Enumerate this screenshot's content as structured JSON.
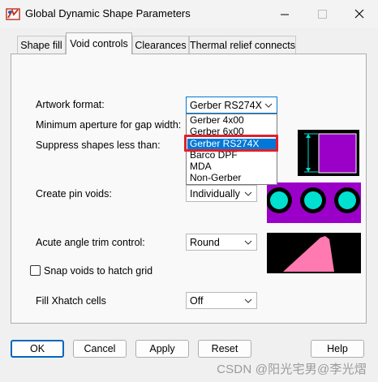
{
  "window": {
    "title": "Global Dynamic Shape Parameters",
    "minimize_icon": "minimize-icon",
    "maximize_icon": "maximize-icon",
    "close_icon": "close-icon"
  },
  "tabs": [
    {
      "label": "Shape fill",
      "active": false
    },
    {
      "label": "Void controls",
      "active": true
    },
    {
      "label": "Clearances",
      "active": false
    },
    {
      "label": "Thermal relief connects",
      "active": false
    }
  ],
  "void_controls": {
    "artwork_format": {
      "label": "Artwork format:",
      "value": "Gerber RS274X"
    },
    "min_aperture": {
      "label": "Minimum aperture for gap width:"
    },
    "suppress_shapes": {
      "label": "Suppress shapes less than:"
    },
    "artwork_options": [
      "Gerber 4x00",
      "Gerber 6x00",
      "Gerber RS274X",
      "Barco DPF",
      "MDA",
      "Non-Gerber"
    ],
    "selected_option_index": 2,
    "create_pin_voids": {
      "label": "Create pin voids:",
      "value": "Individually"
    },
    "acute_angle_trim": {
      "label": "Acute angle trim control:",
      "value": "Round"
    },
    "snap_voids": {
      "label": "Snap voids to hatch grid",
      "checked": false
    },
    "fill_xhatch": {
      "label": "Fill Xhatch cells",
      "value": "Off"
    }
  },
  "buttons": {
    "ok": "OK",
    "cancel": "Cancel",
    "apply": "Apply",
    "reset": "Reset",
    "help": "Help"
  },
  "watermark": "CSDN @阳光宅男@李光熠",
  "colors": {
    "preview_magenta": "#9b00c8",
    "preview_cyan": "#00e0d0",
    "preview_pink": "#ff7ab0",
    "selection_blue": "#0078d7",
    "highlight_red": "#e0202a"
  }
}
